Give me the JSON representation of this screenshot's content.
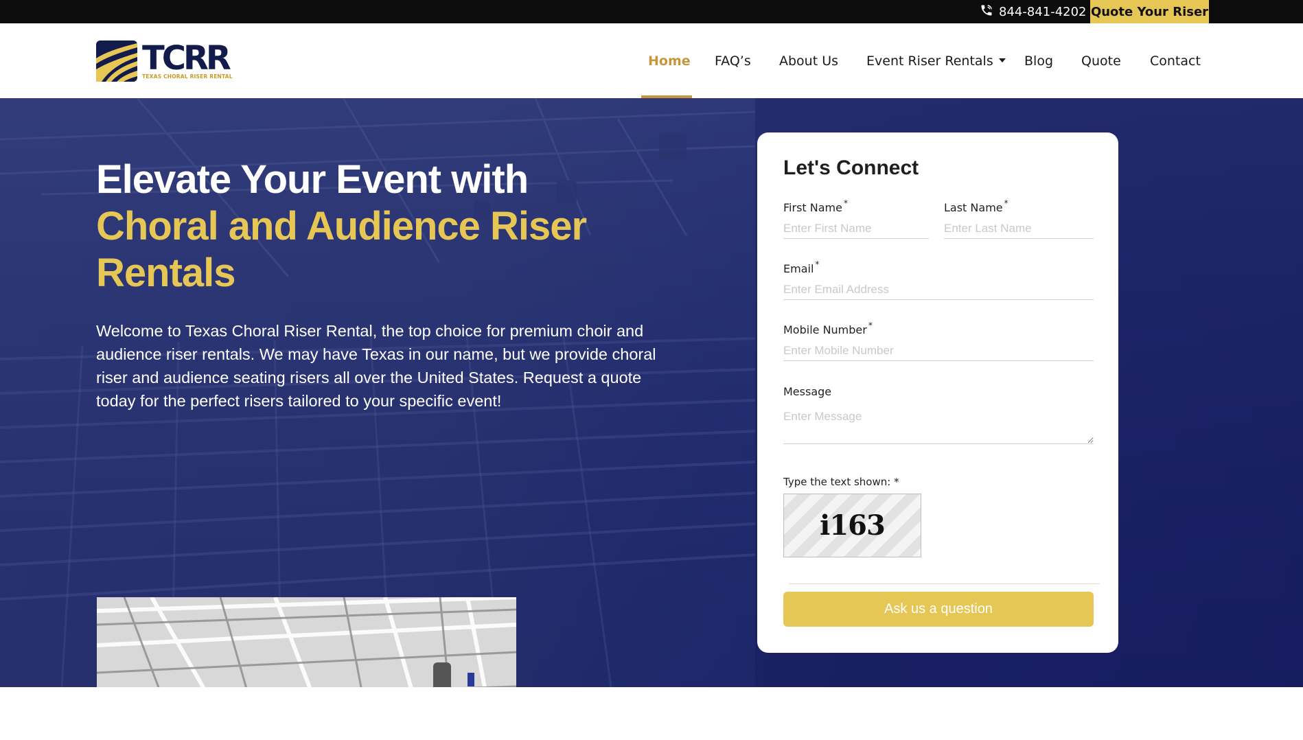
{
  "topbar": {
    "phone_icon": "phone-icon",
    "phone": "844-841-4202",
    "quote_button": "Quote Your Riser"
  },
  "logo": {
    "letters": "TCRR",
    "subtitle": "TEXAS CHORAL RISER RENTAL"
  },
  "nav": {
    "items": [
      {
        "label": "Home",
        "active": true
      },
      {
        "label": "FAQ’s"
      },
      {
        "label": "About Us"
      },
      {
        "label": "Event Riser Rentals",
        "dropdown": true
      },
      {
        "label": "Blog"
      },
      {
        "label": "Quote"
      },
      {
        "label": "Contact"
      }
    ]
  },
  "hero": {
    "title_line1": "Elevate Your Event with",
    "title_line2": "Choral and Audience Riser Rentals",
    "description": "Welcome to Texas Choral Riser Rental, the top choice for premium choir and audience riser rentals. We may have Texas in our name, but we provide choral riser and audience seating risers all over the United States. Request a quote today for the perfect risers tailored to your specific event!"
  },
  "form": {
    "title": "Let's Connect",
    "first_name": {
      "label": "First Name",
      "required": "*",
      "placeholder": "Enter First Name"
    },
    "last_name": {
      "label": "Last Name",
      "required": "*",
      "placeholder": "Enter Last Name"
    },
    "email": {
      "label": "Email",
      "required": "*",
      "placeholder": "Enter Email Address"
    },
    "mobile": {
      "label": "Mobile Number",
      "required": "*",
      "placeholder": "Enter Mobile Number"
    },
    "message": {
      "label": "Message",
      "placeholder": "Enter Message"
    },
    "captcha_label": "Type the text shown: *",
    "captcha_text": "i163",
    "submit_label": "Ask us a question"
  },
  "colors": {
    "gold": "#e6c654",
    "navy": "#1c2268",
    "nav_active": "#c8963a"
  }
}
